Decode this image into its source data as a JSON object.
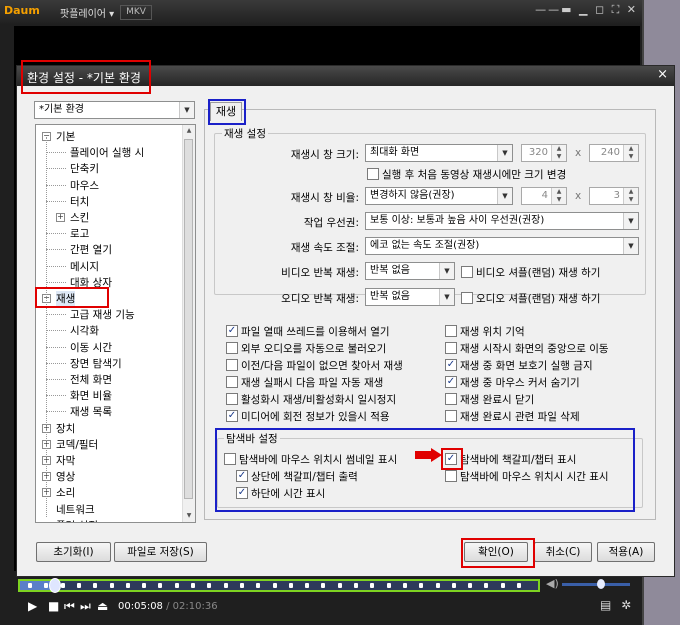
{
  "player": {
    "logo_main": "Daum",
    "app_title": "팟플레이어 ▾",
    "format_badge": "MKV",
    "window_controls": "——▬ ▁ ◻ ⛶ ✕",
    "time_current": "00:05:08",
    "time_separator": " / ",
    "time_total": "02:10:36",
    "seek_progress_fraction": 0.065,
    "volume_fraction": 0.58,
    "icons": [
      "play-icon",
      "stop-icon",
      "prev-icon",
      "next-icon",
      "eject-icon",
      "playlist-icon",
      "settings-icon",
      "volume-icon"
    ]
  },
  "dialog": {
    "title": "환경 설정 - *기본 환경",
    "close": "×",
    "preset": "*기본 환경",
    "tab": "재생",
    "tree": [
      {
        "label": "기본",
        "toggle": "−",
        "level": 0
      },
      {
        "label": "플레이어 실행 시",
        "level": 1
      },
      {
        "label": "단축키",
        "level": 1
      },
      {
        "label": "마우스",
        "level": 1
      },
      {
        "label": "터치",
        "level": 1
      },
      {
        "label": "스킨",
        "toggle": "+",
        "level": 1
      },
      {
        "label": "로고",
        "level": 1
      },
      {
        "label": "간편 열기",
        "level": 1
      },
      {
        "label": "메시지",
        "level": 1
      },
      {
        "label": "대화 상자",
        "level": 1
      },
      {
        "label": "재생",
        "toggle": "−",
        "level": 0,
        "selected": true
      },
      {
        "label": "고급 재생 기능",
        "level": 1
      },
      {
        "label": "시각화",
        "level": 1
      },
      {
        "label": "이동 시간",
        "level": 1
      },
      {
        "label": "장면 탐색기",
        "level": 1
      },
      {
        "label": "전체 화면",
        "level": 1
      },
      {
        "label": "화면 비율",
        "level": 1
      },
      {
        "label": "재생 목록",
        "level": 1
      },
      {
        "label": "장치",
        "toggle": "+",
        "level": 0
      },
      {
        "label": "코덱/필터",
        "toggle": "+",
        "level": 0
      },
      {
        "label": "자막",
        "toggle": "+",
        "level": 0
      },
      {
        "label": "영상",
        "toggle": "+",
        "level": 0
      },
      {
        "label": "소리",
        "toggle": "+",
        "level": 0
      },
      {
        "label": "네트워크",
        "level": 0
      },
      {
        "label": "플러 설정",
        "level": 0
      }
    ],
    "play_settings": {
      "group": "재생 설정",
      "window_size_label": "재생시 창 크기:",
      "window_size_value": "최대화 화면",
      "window_w": "320",
      "window_h": "240",
      "x_sign": "x",
      "first_video_label": "실행 후 처음 동영상 재생시에만 크기 변경",
      "ratio_label": "재생시 창 비율:",
      "ratio_value": "변경하지 않음(권장)",
      "ratio_w": "4",
      "ratio_h": "3",
      "priority_label": "작업 우선권:",
      "priority_value": "보통 이상: 보통과 높음 사이 우선권(권장)",
      "speed_label": "재생 속도 조절:",
      "speed_value": "에코 없는 속도 조절(권장)",
      "video_repeat_label": "비디오 반복 재생:",
      "video_repeat_value": "반복 없음",
      "video_shuffle_label": "비디오 셔플(랜덤) 재생 하기",
      "audio_repeat_label": "오디오 반복 재생:",
      "audio_repeat_value": "반복 없음",
      "audio_shuffle_label": "오디오 셔플(랜덤) 재생 하기"
    },
    "options_left": [
      {
        "label": "파일 열때 쓰레드를 이용해서 열기",
        "checked": true
      },
      {
        "label": "외부 오디오를 자동으로 불러오기",
        "checked": false
      },
      {
        "label": "이전/다음 파일이 없으면 찾아서 재생",
        "checked": false
      },
      {
        "label": "재생 실패시 다음 파일 자동 재생",
        "checked": false
      },
      {
        "label": "활성화시 재생/비활성화시 일시정지",
        "checked": false
      },
      {
        "label": "미디어에 회전 정보가 있을시 적용",
        "checked": true
      }
    ],
    "options_right": [
      {
        "label": "재생 위치 기억",
        "checked": false
      },
      {
        "label": "재생 시작시 화면의 중앙으로 이동",
        "checked": false
      },
      {
        "label": "재생 중 화면 보호기 실행 금지",
        "checked": true
      },
      {
        "label": "재생 중 마우스 커서 숨기기",
        "checked": true
      },
      {
        "label": "재생 완료시 닫기",
        "checked": false
      },
      {
        "label": "재생 완료시 관련 파일 삭제",
        "checked": false
      }
    ],
    "seekbar_settings": {
      "group": "탐색바 설정",
      "thumb_label": "탐색바에 마우스 위치시 썸네일 표시",
      "thumb_checked": false,
      "top_chapter_label": "상단에 책갈피/챕터 출력",
      "top_chapter_checked": true,
      "bottom_time_label": "하단에 시간 표시",
      "bottom_time_checked": true,
      "chapter_label": "탐색바에 책갈피/챕터 표시",
      "chapter_checked": true,
      "time_label": "탐색바에 마우스 위치시 시간 표시",
      "time_checked": false
    },
    "buttons": {
      "reset": "초기화(I)",
      "save_file": "파일로 저장(S)",
      "ok": "확인(O)",
      "cancel": "취소(C)",
      "apply": "적용(A)"
    }
  },
  "colors": {
    "annotation_red": "#e00000",
    "annotation_blue": "#1a20c8",
    "seek_highlight": "#7ed321"
  }
}
